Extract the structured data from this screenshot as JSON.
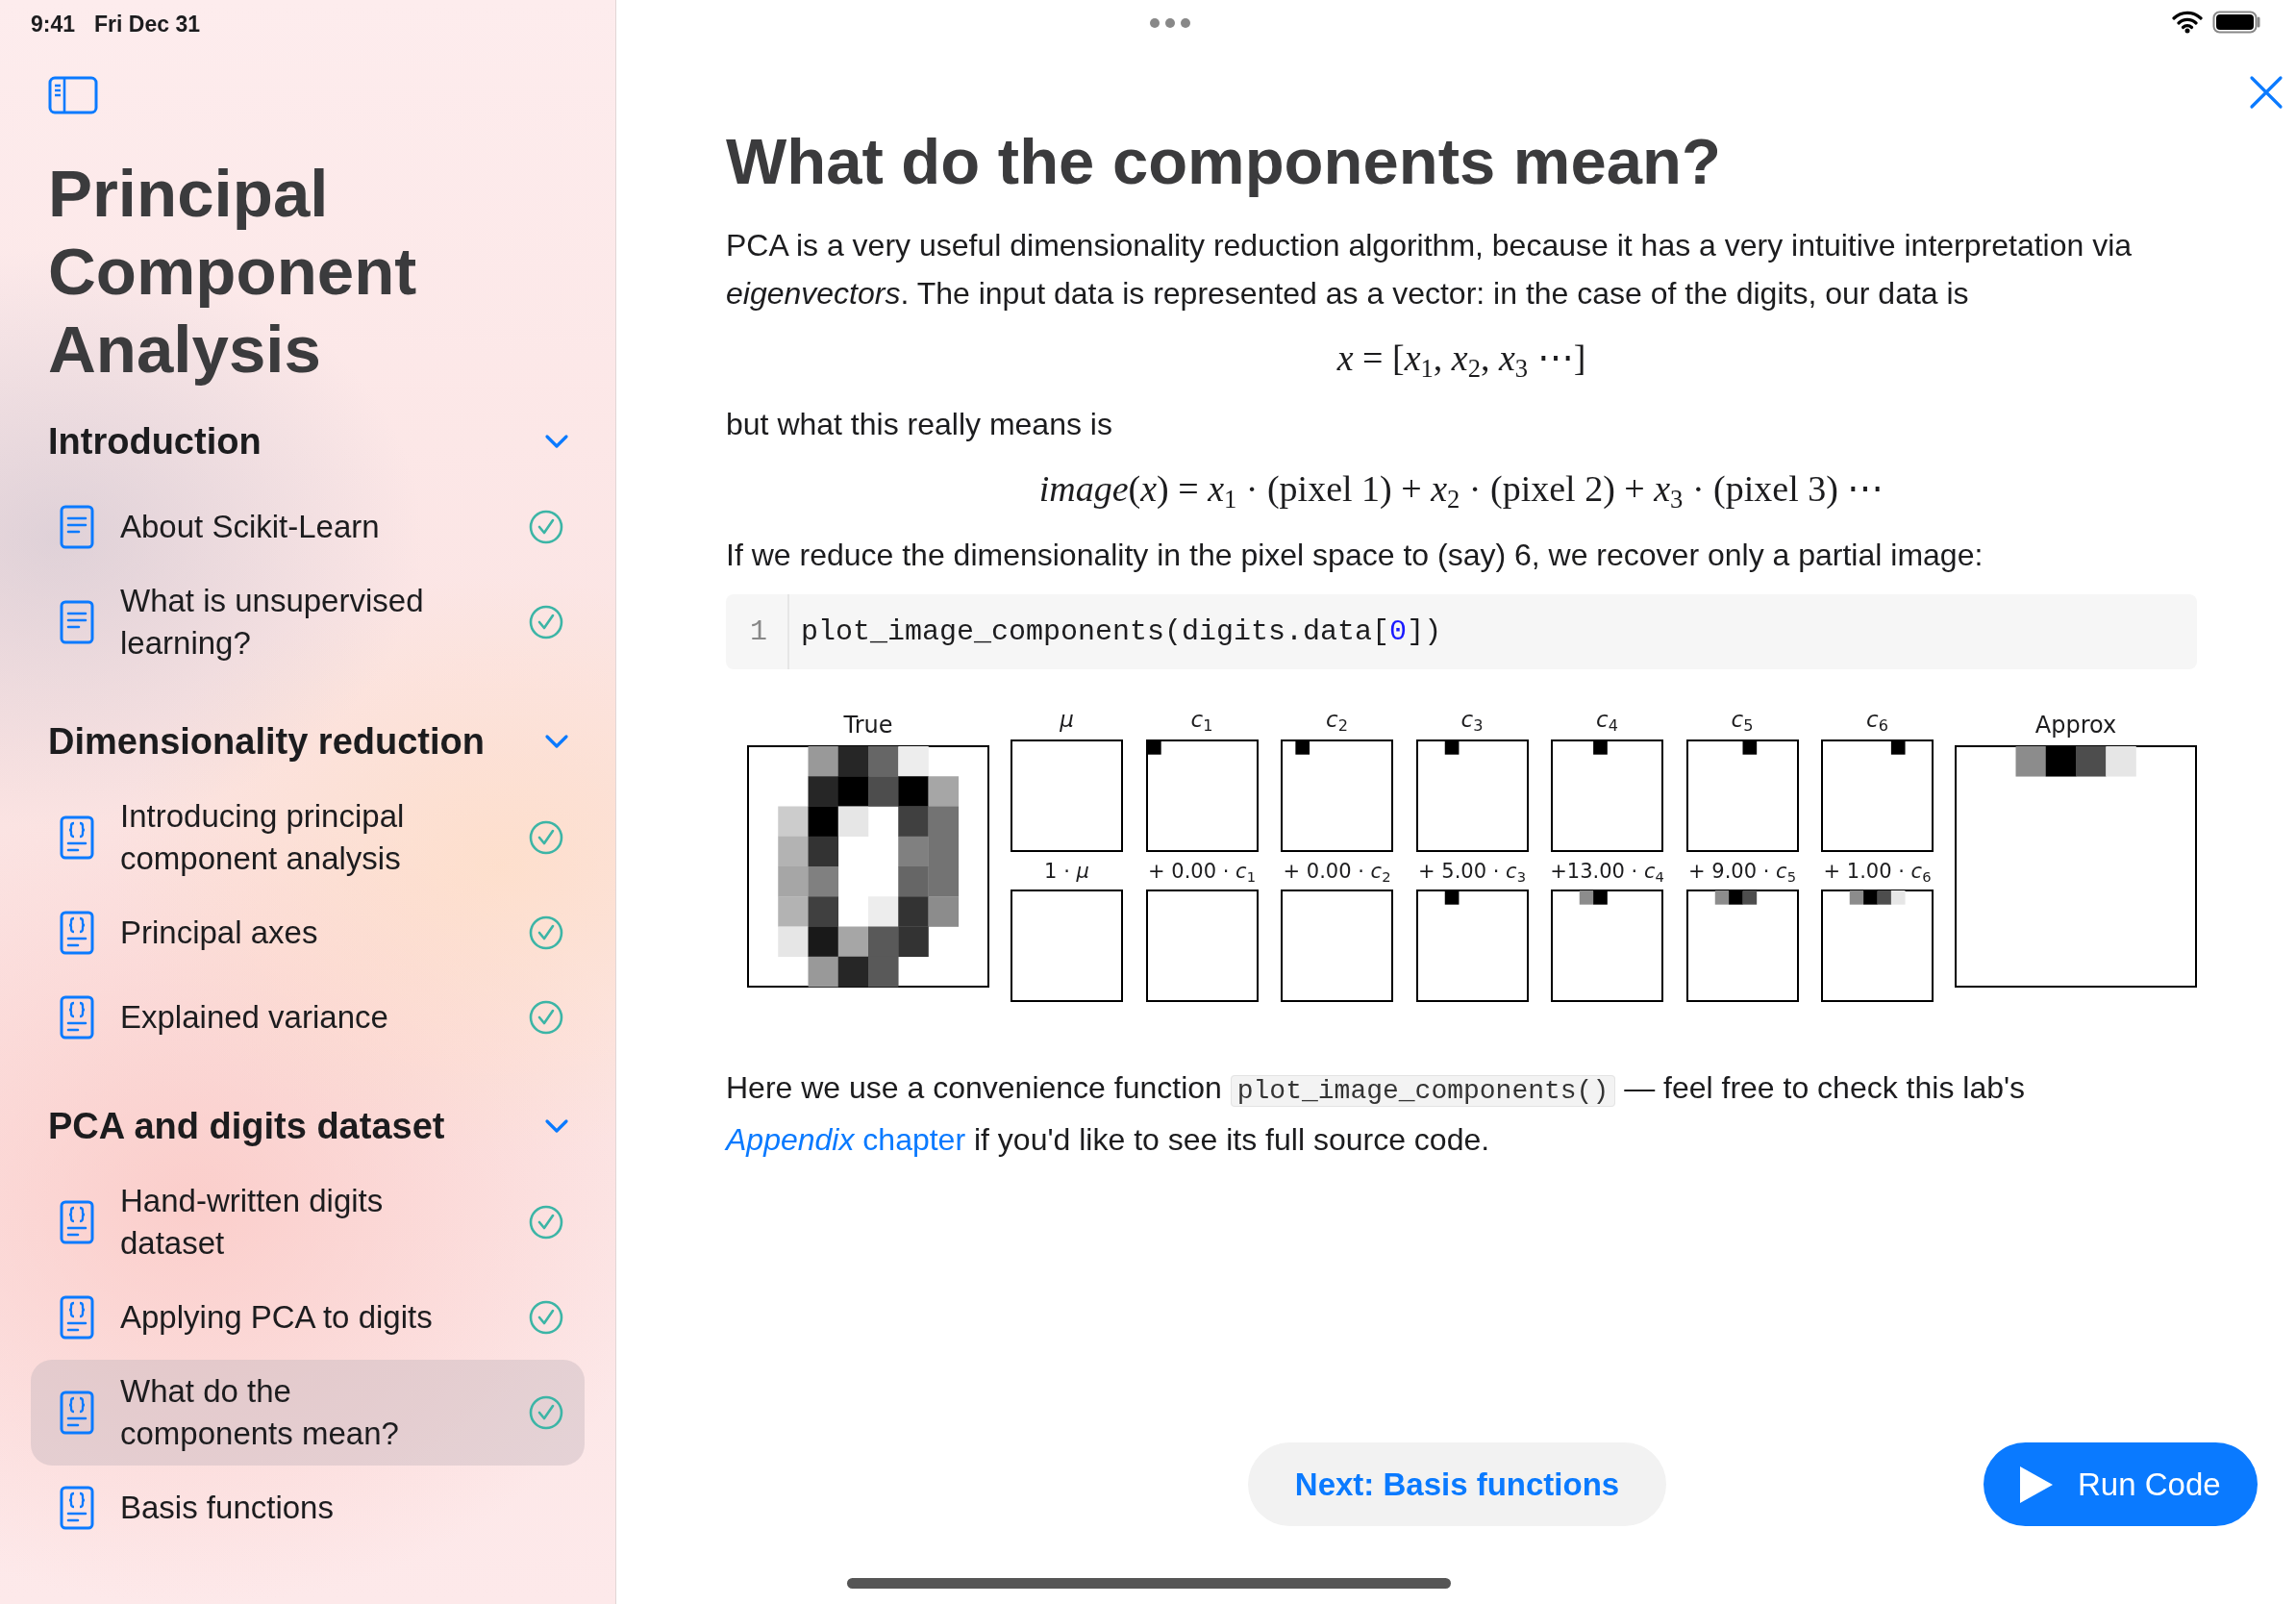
{
  "status_bar": {
    "time": "9:41",
    "date": "Fri Dec 31"
  },
  "sidebar": {
    "title": "Principal Component Analysis",
    "sections": [
      {
        "title": "Introduction",
        "expanded": true,
        "items": [
          {
            "label": "About Scikit-Learn",
            "kind": "document",
            "completed": true,
            "selected": false
          },
          {
            "label": "What is unsupervised learning?",
            "kind": "document",
            "completed": true,
            "selected": false
          }
        ]
      },
      {
        "title": "Dimensionality reduction",
        "expanded": true,
        "items": [
          {
            "label": "Introducing principal component analysis",
            "kind": "code",
            "completed": true,
            "selected": false
          },
          {
            "label": "Principal axes",
            "kind": "code",
            "completed": true,
            "selected": false
          },
          {
            "label": "Explained variance",
            "kind": "code",
            "completed": true,
            "selected": false
          }
        ]
      },
      {
        "title": "PCA and digits dataset",
        "expanded": true,
        "items": [
          {
            "label": "Hand-written digits dataset",
            "kind": "code",
            "completed": true,
            "selected": false
          },
          {
            "label": "Applying PCA to digits",
            "kind": "code",
            "completed": true,
            "selected": false
          },
          {
            "label": "What do the components mean?",
            "kind": "code",
            "completed": true,
            "selected": true
          },
          {
            "label": "Basis functions",
            "kind": "code",
            "completed": false,
            "selected": false
          }
        ]
      }
    ]
  },
  "content": {
    "title": "What do the components mean?",
    "blocks": [
      {
        "kind": "paragraph",
        "text": "PCA is a very useful dimensionality reduction algorithm, because it has a very intuitive interpretation via *eigenvectors*. The input data is represented as a vector: in the case of the digits, our data is"
      },
      {
        "kind": "formula",
        "text": "*x* = [*x*$_{1}$, *x*$_{2}$, *x*$_{3}$ ⋯]"
      },
      {
        "kind": "paragraph",
        "text": "but what this really means is"
      },
      {
        "kind": "formula",
        "text": "*image*(*x*) = *x*$_{1}$ · (pixel 1) + *x*$_{2}$ · (pixel 2) + *x*$_{3}$ · (pixel 3) ⋯"
      },
      {
        "kind": "paragraph",
        "text": "If we reduce the dimensionality in the pixel space to (say) 6, we recover only a partial image:"
      },
      {
        "kind": "code",
        "line_number": "1",
        "tokens": [
          {
            "kind": "plain",
            "text": "plot_image_components(digits.data["
          },
          {
            "kind": "number",
            "text": "0"
          },
          {
            "kind": "plain",
            "text": "])"
          }
        ]
      },
      {
        "kind": "figure",
        "true_title": "True",
        "approx_title": "Approx",
        "columns": [
          {
            "title": "*μ*",
            "term": "1 · *μ*"
          },
          {
            "title": "*c*$_{1}$",
            "term": "+ 0.00 · *c*$_{1}$"
          },
          {
            "title": "*c*$_{2}$",
            "term": "+ 0.00 · *c*$_{2}$"
          },
          {
            "title": "*c*$_{3}$",
            "term": "+ 5.00 · *c*$_{3}$"
          },
          {
            "title": "*c*$_{4}$",
            "term": "+13.00 · *c*$_{4}$"
          },
          {
            "title": "*c*$_{5}$",
            "term": "+ 9.00 · *c*$_{5}$"
          },
          {
            "title": "*c*$_{6}$",
            "term": "+ 1.00 · *c*$_{6}$"
          }
        ]
      },
      {
        "kind": "rich_paragraph",
        "parts": [
          {
            "kind": "text",
            "text": "Here we use a convenience function "
          },
          {
            "kind": "code",
            "text": "plot_image_components()"
          },
          {
            "kind": "text",
            "text": " — feel free to check this lab's "
          },
          {
            "kind": "link",
            "text": "*Appendix* chapter"
          },
          {
            "kind": "text",
            "text": " if you'd like to see its full source code."
          }
        ]
      }
    ],
    "next_button": "Next: Basis functions",
    "run_button": "Run Code"
  }
}
